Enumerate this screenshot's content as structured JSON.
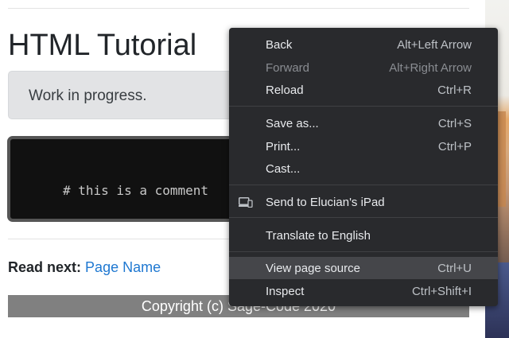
{
  "page": {
    "title": "HTML Tutorial",
    "alert_text": "Work in progress.",
    "code_text": "# this is a comment",
    "read_next_label": "Read next:",
    "read_next_link": "Page Name",
    "footer_text": "Copyright (c) Sage-Code 2020"
  },
  "context_menu": {
    "items": [
      {
        "label": "Back",
        "shortcut": "Alt+Left Arrow",
        "enabled": true
      },
      {
        "label": "Forward",
        "shortcut": "Alt+Right Arrow",
        "enabled": false
      },
      {
        "label": "Reload",
        "shortcut": "Ctrl+R",
        "enabled": true
      },
      {
        "label": "Save as...",
        "shortcut": "Ctrl+S",
        "enabled": true
      },
      {
        "label": "Print...",
        "shortcut": "Ctrl+P",
        "enabled": true
      },
      {
        "label": "Cast...",
        "shortcut": "",
        "enabled": true
      },
      {
        "label": "Send to Elucian's iPad",
        "shortcut": "",
        "icon": "devices-icon",
        "enabled": true
      },
      {
        "label": "Translate to English",
        "shortcut": "",
        "enabled": true
      },
      {
        "label": "View page source",
        "shortcut": "Ctrl+U",
        "enabled": true,
        "highlighted": true
      },
      {
        "label": "Inspect",
        "shortcut": "Ctrl+Shift+I",
        "enabled": true
      }
    ]
  },
  "colors": {
    "menu_background": "#292a2d",
    "menu_highlight": "#45464a",
    "link": "#1f78d1",
    "footer_background": "#808080"
  }
}
